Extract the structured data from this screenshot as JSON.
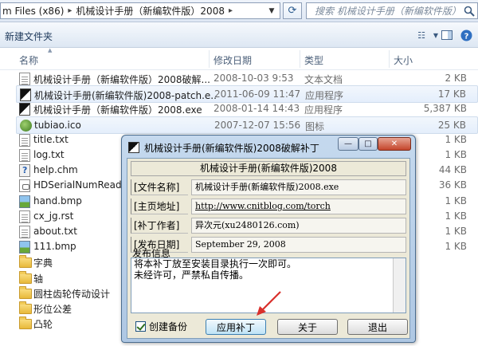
{
  "address": {
    "segments": [
      "m Files (x86)",
      "机械设计手册（新编软件版）2008"
    ],
    "separator": "▸"
  },
  "search": {
    "placeholder": "搜索 机械设计手册（新编软件版）2008"
  },
  "toolbar": {
    "new_folder_label": "新建文件夹"
  },
  "columns": {
    "name": "名称",
    "date": "修改日期",
    "type": "类型",
    "size": "大小"
  },
  "files": [
    {
      "icon": "text-document-icon",
      "name": "机械设计手册（新编软件版）2008破解...",
      "date": "2008-10-03 9:53",
      "type": "文本文档",
      "size": "2 KB"
    },
    {
      "icon": "application-icon",
      "name": "机械设计手册(新编软件版)2008-patch.e...",
      "date": "2011-06-09 11:47",
      "type": "应用程序",
      "size": "17 KB",
      "highlighted": true
    },
    {
      "icon": "application-icon",
      "name": "机械设计手册（新编软件版）2008.exe",
      "date": "2008-01-14 14:43",
      "type": "应用程序",
      "size": "5,387 KB"
    },
    {
      "icon": "green-ball-icon",
      "name": "tubiao.ico",
      "date": "2007-12-07 15:56",
      "type": "图标",
      "size": "25 KB",
      "highlighted": true
    },
    {
      "icon": "text-document-icon",
      "name": "title.txt",
      "date": "",
      "type": "",
      "size": "1 KB"
    },
    {
      "icon": "text-document-icon",
      "name": "log.txt",
      "date": "",
      "type": "",
      "size": "1 KB"
    },
    {
      "icon": "help-file-icon",
      "name": "help.chm",
      "date": "",
      "type": "",
      "size": "44 KB"
    },
    {
      "icon": "dll-file-icon",
      "name": "HDSerialNumRead.d...",
      "date": "",
      "type": "",
      "size": "36 KB"
    },
    {
      "icon": "bitmap-icon",
      "name": "hand.bmp",
      "date": "",
      "type": "",
      "size": "1 KB"
    },
    {
      "icon": "text-document-icon",
      "name": "cx_jg.rst",
      "date": "",
      "type": "",
      "size": "1 KB"
    },
    {
      "icon": "text-document-icon",
      "name": "about.txt",
      "date": "",
      "type": "",
      "size": "1 KB"
    },
    {
      "icon": "bitmap-icon",
      "name": "111.bmp",
      "date": "",
      "type": "",
      "size": "1 KB"
    },
    {
      "icon": "folder-icon",
      "name": "字典",
      "date": "",
      "type": "",
      "size": ""
    },
    {
      "icon": "folder-icon",
      "name": "轴",
      "date": "",
      "type": "",
      "size": ""
    },
    {
      "icon": "folder-icon",
      "name": "圆柱齿轮传动设计",
      "date": "",
      "type": "",
      "size": ""
    },
    {
      "icon": "folder-icon",
      "name": "形位公差",
      "date": "",
      "type": "",
      "size": ""
    },
    {
      "icon": "folder-icon",
      "name": "凸轮",
      "date": "",
      "type": "",
      "size": ""
    }
  ],
  "dialog": {
    "title": "机械设计手册(新编软件版)2008破解补丁",
    "heading": "机械设计手册(新编软件版)2008",
    "fields": [
      {
        "label": "[文件名称]",
        "value": "机械设计手册(新编软件版)2008.exe"
      },
      {
        "label": "[主页地址]",
        "value": "http://www.cnitblog.com/torch"
      },
      {
        "label": "[补丁作者]",
        "value": "异次元(xu2480126.com)"
      },
      {
        "label": "[发布日期]",
        "value": "September 29, 2008"
      }
    ],
    "notes_label": "发布信息",
    "notes_lines": [
      "将本补丁放至安装目录执行一次即可。",
      "未经许可，严禁私自传播。"
    ],
    "backup_label": "创建备份",
    "backup_checked": true,
    "buttons": {
      "apply": "应用补丁",
      "about": "关于",
      "exit": "退出"
    },
    "window_controls": {
      "minimize": "—",
      "maximize": "□",
      "close": "✕"
    }
  },
  "colors": {
    "annotation_arrow": "#d9302c",
    "selection": "#e4eefb"
  }
}
